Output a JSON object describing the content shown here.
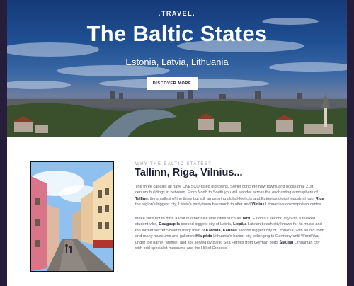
{
  "hero": {
    "brand": ".TRAVEL.",
    "title": "The Baltic States",
    "subtitle": "Estonia, Latvia, Lithuania",
    "cta_label": "DISCOVER MORE"
  },
  "section": {
    "eyebrow": "WHY THE BALTIC STATES?",
    "title": "Tallinn, Riga, Vilnius...",
    "p1": {
      "t1": "The three capitals all have UNESCO-listed old towns, Soviet concrete new towns and occasional 21st century buildings in between. From North to South you will wander across the enchanting atmosphere of ",
      "b1": "Tallinn",
      "t2": ", the smallest of the three but still an aspiring global-feel city and Estonia's digital industrial hub, ",
      "b2": "Riga",
      "t3": " the region's biggest city, Latvia's party town has much to offer and ",
      "b3": "Vilnius",
      "t4": " Lithuania's cosmopolitan centre."
    },
    "p2": {
      "t1": "Make sure not to miss a visit in other nice little cities such as ",
      "b1": "Tartu",
      "t2": " Estonia's second city with a relaxed student vibe, ",
      "b2": "Daugavpils",
      "t3": " second biggest city of Latvia, ",
      "b3": "Liepāja",
      "t4": " Latvian beach city known for its music and the former secret Soviet military town of ",
      "b4": "Karosta",
      "t5": ", ",
      "b5": "Kaunas",
      "t6": " second biggest city of Lithuania, with an old town and many museums and galleries ",
      "b6": "Klaipėda",
      "t7": " Lithuania's harbor city belonging to Germany until World War I under the name \"Memel\" and still served by Baltic Sea Ferries from German ports ",
      "b7": "Šiauliai",
      "t8": " Lithuanian city with odd specialist museums and the Hill of Crosses."
    }
  },
  "colors": {
    "frame": "#261d3b",
    "title_text": "#1e1e35",
    "body_text": "#5b5b66",
    "eyebrow_text": "#9a9aa8"
  }
}
